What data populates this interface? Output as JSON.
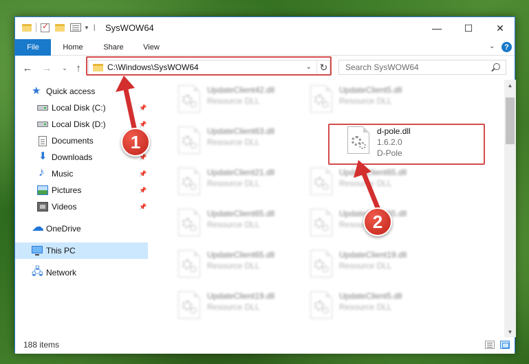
{
  "window": {
    "title": "SysWOW64"
  },
  "ribbon": {
    "tabs": [
      "File",
      "Home",
      "Share",
      "View"
    ],
    "help": "?"
  },
  "address": {
    "path": "C:\\Windows\\SysWOW64"
  },
  "search": {
    "placeholder": "Search SysWOW64"
  },
  "nav": {
    "items": [
      {
        "label": "Quick access",
        "icon": "star-icon"
      },
      {
        "label": "Local Disk (C:)",
        "icon": "disk-icon"
      },
      {
        "label": "Local Disk (D:)",
        "icon": "disk-icon"
      },
      {
        "label": "Documents",
        "icon": "document-icon"
      },
      {
        "label": "Downloads",
        "icon": "download-icon"
      },
      {
        "label": "Music",
        "icon": "music-icon"
      },
      {
        "label": "Pictures",
        "icon": "pictures-icon"
      },
      {
        "label": "Videos",
        "icon": "videos-icon"
      },
      {
        "label": "OneDrive",
        "icon": "cloud-icon"
      },
      {
        "label": "This PC",
        "icon": "computer-icon"
      },
      {
        "label": "Network",
        "icon": "network-icon"
      }
    ]
  },
  "files": [
    {
      "name": "UpdateClient42.dll",
      "line2": "Resource DLL",
      "line3": ""
    },
    {
      "name": "UpdateClient5.dll",
      "line2": "Resource DLL",
      "line3": ""
    },
    {
      "name": "UpdateClient63.dll",
      "line2": "Resource DLL",
      "line3": ""
    },
    {
      "name": "d-pole.dll",
      "line2": "1.6.2.0",
      "line3": "D-Pole"
    },
    {
      "name": "UpdateClient21.dll",
      "line2": "Resource DLL",
      "line3": ""
    },
    {
      "name": "UpdateClient65.dll",
      "line2": "Resource DLL",
      "line3": ""
    },
    {
      "name": "UpdateClient65.dll",
      "line2": "Resource DLL",
      "line3": ""
    },
    {
      "name": "UpdateClient65.dll",
      "line2": "Resource DLL",
      "line3": ""
    },
    {
      "name": "UpdateClient65.dll",
      "line2": "Resource DLL",
      "line3": ""
    },
    {
      "name": "UpdateClient19.dll",
      "line2": "Resource DLL",
      "line3": ""
    },
    {
      "name": "UpdateClient19.dll",
      "line2": "Resource DLL",
      "line3": ""
    },
    {
      "name": "UpdateClient5.dll",
      "line2": "Resource DLL",
      "line3": ""
    }
  ],
  "status": {
    "count": "188 items"
  },
  "callouts": {
    "one": "1",
    "two": "2"
  },
  "colors": {
    "accent": "#1979ca",
    "highlight": "#d44a4a",
    "selected": "#cce8ff"
  }
}
